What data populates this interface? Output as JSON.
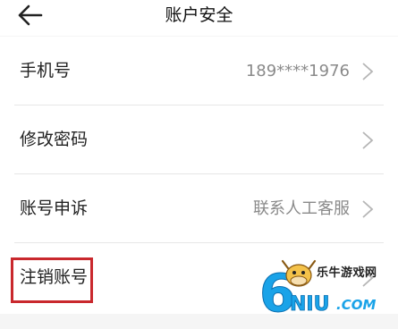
{
  "header": {
    "back_icon": "arrow-left-icon",
    "title": "账户安全"
  },
  "rows": [
    {
      "label": "手机号",
      "value": "189****1976",
      "icon": "chevron-right-icon"
    },
    {
      "label": "修改密码",
      "value": "",
      "icon": "chevron-right-icon"
    },
    {
      "label": "账号申诉",
      "value": "联系人工客服",
      "icon": "chevron-right-icon"
    },
    {
      "label": "注销账号",
      "value": "",
      "icon": "chevron-right-icon"
    }
  ],
  "highlight_color": "#c9282d",
  "watermark": {
    "text": "乐牛游戏网",
    "logo": "6NIU.COM"
  }
}
